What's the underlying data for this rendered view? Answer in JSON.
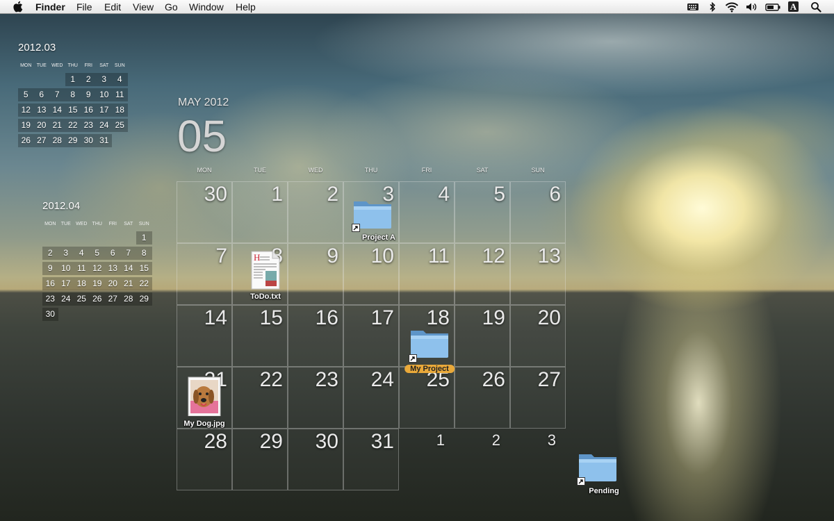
{
  "menubar": {
    "apple_icon": "apple-icon",
    "app_name": "Finder",
    "menus": [
      "File",
      "Edit",
      "View",
      "Go",
      "Window",
      "Help"
    ],
    "status_icons": [
      "keyboard-icon",
      "bluetooth-icon",
      "wifi-icon",
      "volume-icon",
      "battery-icon",
      "input-source-icon",
      "spotlight-icon"
    ],
    "input_source_label": "A"
  },
  "mini_calendars": [
    {
      "title": "2012.03",
      "weekdays": [
        "MON",
        "TUE",
        "WED",
        "THU",
        "FRI",
        "SAT",
        "SUN"
      ],
      "leading_blanks": 3,
      "days": [
        "1",
        "2",
        "3",
        "4",
        "5",
        "6",
        "7",
        "8",
        "9",
        "10",
        "11",
        "12",
        "13",
        "14",
        "15",
        "16",
        "17",
        "18",
        "19",
        "20",
        "21",
        "22",
        "23",
        "24",
        "25",
        "26",
        "27",
        "28",
        "29",
        "30",
        "31"
      ]
    },
    {
      "title": "2012.04",
      "weekdays": [
        "MON",
        "TUE",
        "WED",
        "THU",
        "FRI",
        "SAT",
        "SUN"
      ],
      "leading_blanks": 6,
      "days": [
        "1",
        "2",
        "3",
        "4",
        "5",
        "6",
        "7",
        "8",
        "9",
        "10",
        "11",
        "12",
        "13",
        "14",
        "15",
        "16",
        "17",
        "18",
        "19",
        "20",
        "21",
        "22",
        "23",
        "24",
        "25",
        "26",
        "27",
        "28",
        "29",
        "30"
      ]
    }
  ],
  "main_calendar": {
    "month_title": "MAY 2012",
    "month_number": "05",
    "weekdays": [
      "MON",
      "TUE",
      "WED",
      "THU",
      "FRI",
      "SAT",
      "SUN"
    ],
    "weeks": [
      [
        {
          "d": "30",
          "in": true
        },
        {
          "d": "1",
          "in": true
        },
        {
          "d": "2",
          "in": true
        },
        {
          "d": "3",
          "in": true
        },
        {
          "d": "4",
          "in": true
        },
        {
          "d": "5",
          "in": true
        },
        {
          "d": "6",
          "in": true
        }
      ],
      [
        {
          "d": "7",
          "in": true
        },
        {
          "d": "8",
          "in": true
        },
        {
          "d": "9",
          "in": true
        },
        {
          "d": "10",
          "in": true
        },
        {
          "d": "11",
          "in": true
        },
        {
          "d": "12",
          "in": true
        },
        {
          "d": "13",
          "in": true
        }
      ],
      [
        {
          "d": "14",
          "in": true
        },
        {
          "d": "15",
          "in": true
        },
        {
          "d": "16",
          "in": true
        },
        {
          "d": "17",
          "in": true
        },
        {
          "d": "18",
          "in": true
        },
        {
          "d": "19",
          "in": true
        },
        {
          "d": "20",
          "in": true
        }
      ],
      [
        {
          "d": "21",
          "in": true
        },
        {
          "d": "22",
          "in": true
        },
        {
          "d": "23",
          "in": true
        },
        {
          "d": "24",
          "in": true
        },
        {
          "d": "25",
          "in": true
        },
        {
          "d": "26",
          "in": true
        },
        {
          "d": "27",
          "in": true
        }
      ],
      [
        {
          "d": "28",
          "in": true
        },
        {
          "d": "29",
          "in": true
        },
        {
          "d": "30",
          "in": true
        },
        {
          "d": "31",
          "in": true
        },
        {
          "d": "1",
          "in": false
        },
        {
          "d": "2",
          "in": false
        },
        {
          "d": "3",
          "in": false
        }
      ]
    ]
  },
  "desktop_icons": {
    "project_a": {
      "label": "Project A",
      "type": "folder-alias"
    },
    "todo": {
      "label": "ToDo.txt",
      "type": "text-document"
    },
    "my_project": {
      "label": "My Project",
      "type": "folder-alias",
      "selected": true
    },
    "my_dog": {
      "label": "My Dog.jpg",
      "type": "image-file"
    },
    "pending": {
      "label": "Pending",
      "type": "folder-alias"
    }
  },
  "colors": {
    "selection_label": "#e9a93a",
    "folder_blue": "#7fb6e6"
  }
}
